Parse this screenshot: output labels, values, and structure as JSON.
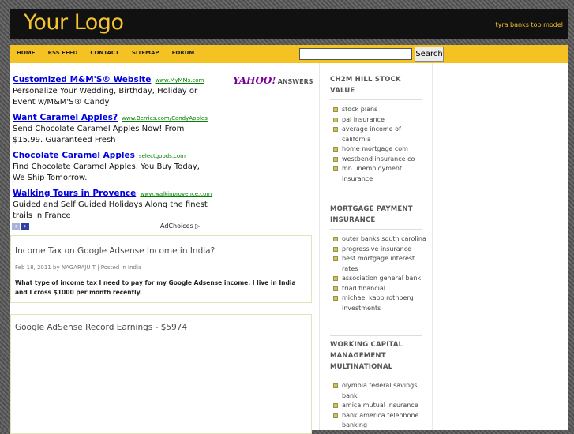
{
  "header": {
    "logo": "Your Logo",
    "tagline": "tyra banks top model"
  },
  "nav": [
    "HOME",
    "RSS FEED",
    "CONTACT",
    "SITEMAP",
    "FORUM"
  ],
  "search": {
    "value": "",
    "button": "Search"
  },
  "yahoo": {
    "logo": "YAHOO!",
    "answers": "ANSWERS"
  },
  "ads": [
    {
      "title": "Customized M&M'S® Website",
      "url": "www.MyMMs.com",
      "text": "Personalize Your Wedding, Birthday, Holiday or Event w/M&M'S® Candy"
    },
    {
      "title": "Want Caramel Apples?",
      "url": "www.Berries.com/CandyApples",
      "text": "Send Chocolate Caramel Apples Now! From $15.99. Guaranteed Fresh"
    },
    {
      "title": "Chocolate Caramel Apples",
      "url": "selectgoods.com",
      "text": "Find Chocolate Caramel Apples. You Buy Today, We Ship Tomorrow."
    },
    {
      "title": "Walking Tours in Provence",
      "url": "www.walkinprovence.com",
      "text": "Guided and Self Guided Holidays Along the finest trails in France"
    }
  ],
  "ad_controls": {
    "prev": "‹",
    "next": "›",
    "adchoices": "AdChoices ▷"
  },
  "posts": [
    {
      "title": "Income Tax on Google Adsense Income in India?",
      "meta": "Feb 18, 2011 by NAGARAJU T | Posted in India",
      "excerpt": "What type of income tax I need to pay for my Google Adsense income. I live in India and I cross $1000 per month recently."
    },
    {
      "title": "Google AdSense Record Earnings - $5974"
    }
  ],
  "sidebar": [
    {
      "title": "CH2M HILL STOCK VALUE",
      "items": [
        "stock plans",
        "pai insurance",
        "average income of california",
        "home mortgage com",
        "westbend insurance co",
        "mn unemployment insurance"
      ]
    },
    {
      "title": "MORTGAGE PAYMENT INSURANCE",
      "items": [
        "outer banks south carolina",
        "progressive insurance",
        "best mortgage interest rates",
        "association general bank",
        "triad financial",
        "michael kapp rothberg investments"
      ]
    },
    {
      "title": "WORKING CAPITAL MANAGEMENT MULTINATIONAL",
      "items": [
        "olympia federal savings bank",
        "amica mutual insurance",
        "bank america telephone banking"
      ]
    }
  ]
}
